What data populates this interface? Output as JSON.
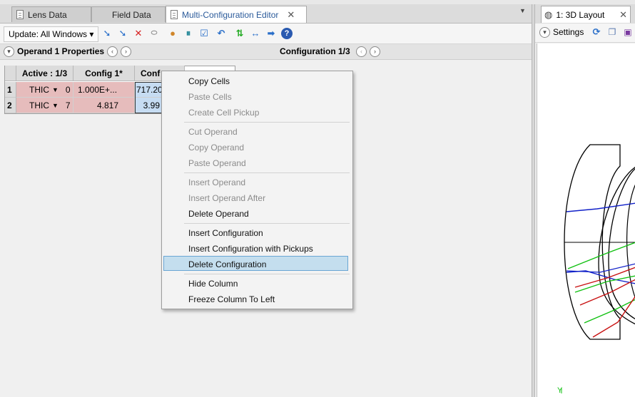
{
  "tabs": [
    {
      "label": "Lens Data"
    },
    {
      "label": "Field Data"
    },
    {
      "label": "Multi-Configuration Editor"
    }
  ],
  "toolbar": {
    "update_label": "Update: All Windows ▾"
  },
  "properties_bar": {
    "operand_props": "Operand 1 Properties",
    "configuration": "Configuration 1/3"
  },
  "grid": {
    "headers": [
      "Active : 1/3",
      "Config 1*",
      "Conf"
    ],
    "rows": [
      {
        "num": "1",
        "type": "THIC",
        "param": "0",
        "config1": "1.000E+...",
        "config2": "717.20"
      },
      {
        "num": "2",
        "type": "THIC",
        "param": "7",
        "config1": "4.817",
        "config2": "3.99"
      }
    ]
  },
  "context_menu": {
    "items": [
      {
        "label": "Copy Cells",
        "enabled": true
      },
      {
        "label": "Paste Cells",
        "enabled": false
      },
      {
        "label": "Create Cell Pickup",
        "enabled": false
      },
      {
        "label": "Cut Operand",
        "enabled": false
      },
      {
        "label": "Copy Operand",
        "enabled": false
      },
      {
        "label": "Paste Operand",
        "enabled": false
      },
      {
        "label": "Insert Operand",
        "enabled": false
      },
      {
        "label": "Insert Operand After",
        "enabled": false
      },
      {
        "label": "Delete Operand",
        "enabled": true
      },
      {
        "label": "Insert Configuration",
        "enabled": true
      },
      {
        "label": "Insert Configuration with Pickups",
        "enabled": true
      },
      {
        "label": "Delete Configuration",
        "enabled": true,
        "highlighted": true
      },
      {
        "label": "Hide Column",
        "enabled": true
      },
      {
        "label": "Freeze Column To Left",
        "enabled": true
      }
    ]
  },
  "right_panel": {
    "tab_label": "1: 3D Layout",
    "settings_label": "Settings",
    "axis_label": "Y"
  },
  "colors": {
    "ray_blue": "#1020c8",
    "ray_green": "#10c010",
    "ray_red": "#c81010",
    "selection": "#c4deee"
  }
}
